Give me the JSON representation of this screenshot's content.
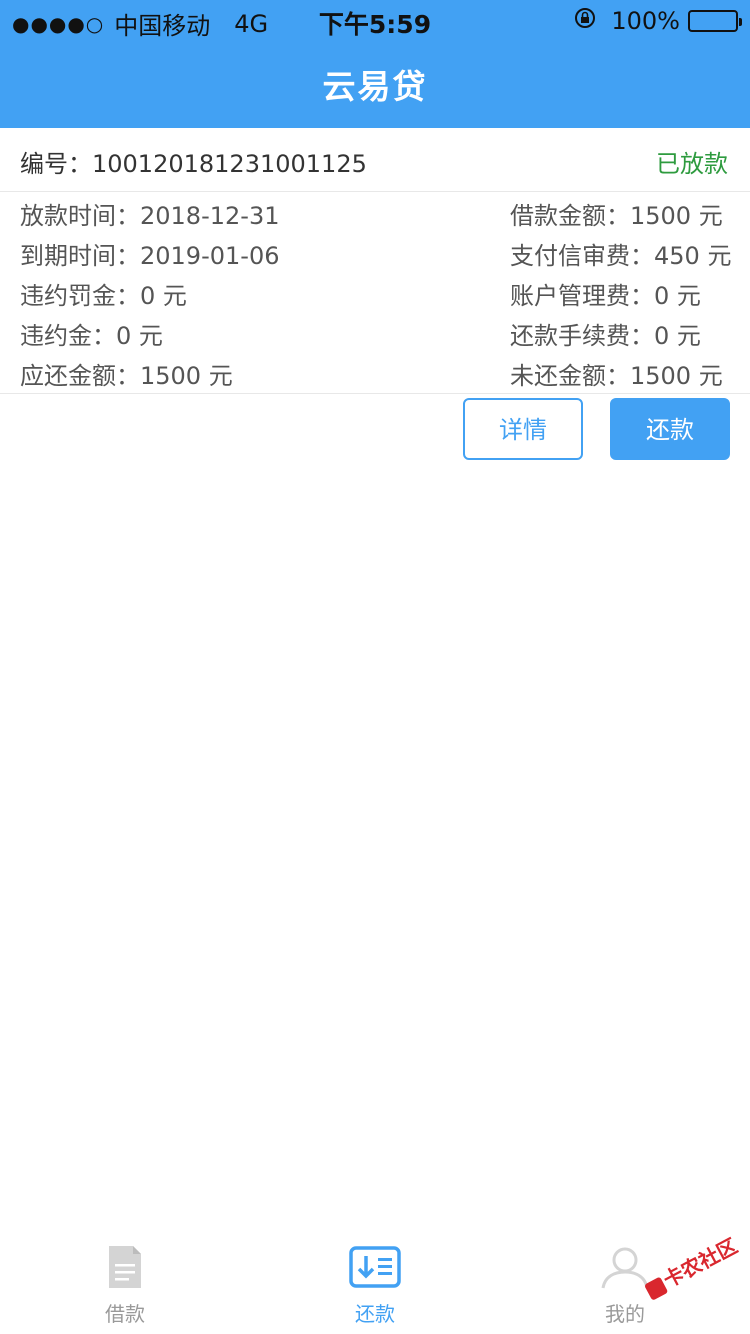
{
  "status_bar": {
    "signal_dots": "●●●●○",
    "carrier": "中国移动",
    "network": "4G",
    "time": "下午5:59",
    "battery_percent": "100%",
    "battery_level": 1.0
  },
  "header": {
    "title": "云易贷"
  },
  "order": {
    "number_label": "编号：",
    "number": "100120181231001125",
    "status": "已放款"
  },
  "details": {
    "left": [
      {
        "label": "放款时间：",
        "value": "2018-12-31"
      },
      {
        "label": "到期时间：",
        "value": "2019-01-06"
      },
      {
        "label": "违约罚金：",
        "value": "0 元"
      },
      {
        "label": "违约金：",
        "value": "0 元"
      },
      {
        "label": "应还金额：",
        "value": "1500 元"
      }
    ],
    "right": [
      {
        "label": "借款金额：",
        "value": "1500 元"
      },
      {
        "label": "支付信审费：",
        "value": "450 元"
      },
      {
        "label": "账户管理费：",
        "value": "0 元"
      },
      {
        "label": "还款手续费：",
        "value": "0 元"
      },
      {
        "label": "未还金额：",
        "value": "1500 元"
      }
    ]
  },
  "actions": {
    "detail_label": "详情",
    "repay_label": "还款"
  },
  "tabbar": {
    "items": [
      {
        "label": "借款",
        "icon": "document-icon"
      },
      {
        "label": "还款",
        "icon": "repay-list-icon"
      },
      {
        "label": "我的",
        "icon": "user-icon"
      }
    ],
    "active_index": 1
  },
  "watermark": {
    "text": "卡农社区"
  },
  "colors": {
    "brand": "#42a1f3",
    "status_green": "#2e9b3f",
    "tab_inactive": "#9a9a9a"
  }
}
